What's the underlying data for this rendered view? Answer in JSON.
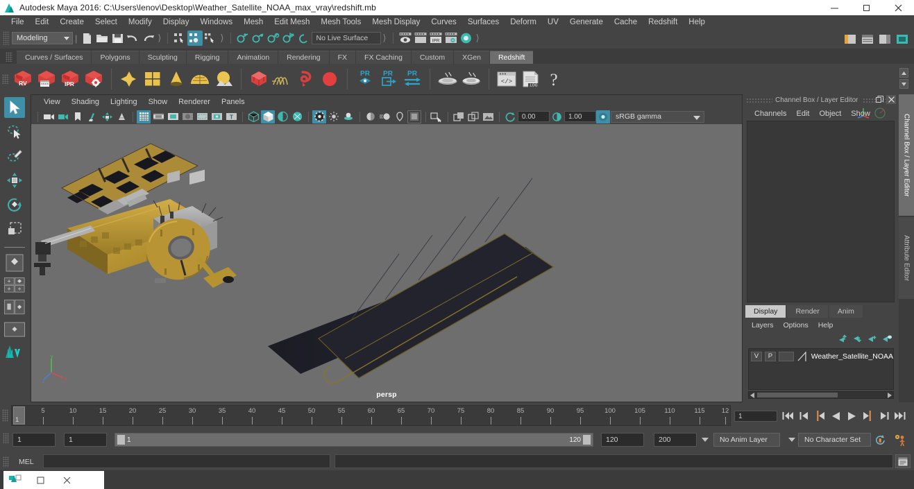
{
  "window": {
    "title": "Autodesk Maya 2016: C:\\Users\\lenov\\Desktop\\Weather_Satellite_NOAA_max_vray\\redshift.mb",
    "icon": "maya-logo-icon",
    "minimize": "–",
    "maximize": "❐",
    "close": "✕"
  },
  "menubar": {
    "items": [
      {
        "label": "File"
      },
      {
        "label": "Edit"
      },
      {
        "label": "Create"
      },
      {
        "label": "Select"
      },
      {
        "label": "Modify"
      },
      {
        "label": "Display"
      },
      {
        "label": "Windows"
      },
      {
        "label": "Mesh"
      },
      {
        "label": "Edit Mesh"
      },
      {
        "label": "Mesh Tools"
      },
      {
        "label": "Mesh Display"
      },
      {
        "label": "Curves"
      },
      {
        "label": "Surfaces"
      },
      {
        "label": "Deform"
      },
      {
        "label": "UV"
      },
      {
        "label": "Generate"
      },
      {
        "label": "Cache"
      },
      {
        "label": "Redshift"
      },
      {
        "label": "Help"
      }
    ]
  },
  "statusline": {
    "menuset": "Modeling",
    "live_surface": "No Live Surface",
    "icons": [
      "new-scene-icon",
      "open-scene-icon",
      "save-scene-icon",
      "undo-icon",
      "redo-icon",
      "select-by-hierarchy-icon",
      "select-by-object-icon",
      "select-by-component-icon",
      "snap-to-grid-icon",
      "snap-to-curve-icon",
      "snap-to-point-icon",
      "snap-to-projected-center-icon",
      "snap-to-view-plane-icon",
      "render-view-icon",
      "render-sequence-icon",
      "ipr-render-icon",
      "render-settings-icon",
      "hypershade-icon"
    ],
    "right_icons": [
      "sidebar-toggle-1-icon",
      "sidebar-toggle-2-icon",
      "sidebar-toggle-3-icon",
      "sidebar-toggle-4-icon"
    ]
  },
  "shelf": {
    "tabs": [
      {
        "label": "Curves / Surfaces",
        "active": false
      },
      {
        "label": "Polygons",
        "active": false
      },
      {
        "label": "Sculpting",
        "active": false
      },
      {
        "label": "Rigging",
        "active": false
      },
      {
        "label": "Animation",
        "active": false
      },
      {
        "label": "Rendering",
        "active": false
      },
      {
        "label": "FX",
        "active": false
      },
      {
        "label": "FX Caching",
        "active": false
      },
      {
        "label": "Custom",
        "active": false
      },
      {
        "label": "XGen",
        "active": false
      },
      {
        "label": "Redshift",
        "active": true
      }
    ],
    "buttons": [
      {
        "name": "redshift-render-view-icon",
        "label": "RV"
      },
      {
        "name": "redshift-render-sequence-icon",
        "label": ""
      },
      {
        "name": "redshift-ipr-icon",
        "label": "IPR"
      },
      {
        "name": "redshift-render-options-icon",
        "label": ""
      },
      {
        "name": "redshift-material-icon",
        "label": ""
      },
      {
        "name": "redshift-matte-icon",
        "label": ""
      },
      {
        "name": "redshift-light-cone-icon",
        "label": ""
      },
      {
        "name": "redshift-dome-light-icon",
        "label": ""
      },
      {
        "name": "redshift-ies-light-icon",
        "label": ""
      },
      {
        "name": "redshift-proxy-icon",
        "label": ""
      },
      {
        "name": "redshift-hair-icon",
        "label": ""
      },
      {
        "name": "redshift-volume-icon",
        "label": ""
      },
      {
        "name": "redshift-sphere-icon",
        "label": ""
      },
      {
        "name": "redshift-pr-object-icon",
        "label": "PR"
      },
      {
        "name": "redshift-pr-export-icon",
        "label": "PR"
      },
      {
        "name": "redshift-pr-transfer-icon",
        "label": "PR"
      },
      {
        "name": "redshift-bake-icon",
        "label": ""
      },
      {
        "name": "redshift-bake-set-icon",
        "label": ""
      },
      {
        "name": "redshift-script-editor-icon",
        "label": ""
      },
      {
        "name": "redshift-log-icon",
        "label": ".LOG"
      },
      {
        "name": "redshift-help-icon",
        "label": "?"
      }
    ]
  },
  "toolbox": {
    "tools": [
      {
        "name": "select-tool",
        "active": true
      },
      {
        "name": "lasso-select-tool",
        "active": false
      },
      {
        "name": "paint-select-tool",
        "active": false
      },
      {
        "name": "move-tool",
        "active": false
      },
      {
        "name": "rotate-tool",
        "active": false
      },
      {
        "name": "scale-tool",
        "active": false
      }
    ],
    "layouts": [
      {
        "name": "single-perspective-layout"
      },
      {
        "name": "four-view-layout"
      },
      {
        "name": "persp-outliner-layout"
      },
      {
        "name": "persp-graph-layout"
      },
      {
        "name": "maya-logo-watermark"
      }
    ]
  },
  "viewport": {
    "menus": [
      {
        "label": "View"
      },
      {
        "label": "Shading"
      },
      {
        "label": "Lighting"
      },
      {
        "label": "Show"
      },
      {
        "label": "Renderer"
      },
      {
        "label": "Panels"
      }
    ],
    "camera_label": "persp",
    "exposure": "0.00",
    "gamma": "1.00",
    "color_management": "sRGB gamma",
    "toolbar_icons": [
      "select-camera-icon",
      "bookmark-camera-icon",
      "camera-attributes-icon",
      "image-plane-icon",
      "two-d-pan-zoom-icon",
      "grid-toggle-icon",
      "film-gate-icon",
      "resolution-gate-icon",
      "gate-mask-icon",
      "field-chart-icon",
      "safe-action-icon",
      "safe-title-icon",
      "wireframe-shading-icon",
      "smooth-shade-all-icon",
      "smooth-shade-selected-icon",
      "shaded-wireframe-icon",
      "texture-toggle-icon",
      "lighting-toggle-icon",
      "shadows-toggle-icon",
      "screen-space-ao-icon",
      "motion-blur-icon",
      "multisample-aa-icon",
      "depth-of-field-icon",
      "isolate-select-icon",
      "xray-toggle-icon",
      "xray-joints-icon",
      "xray-active-components-icon",
      "exposure-icon",
      "gamma-icon",
      "color-management-icon"
    ],
    "scene_object": "Weather Satellite NOAA 3D model"
  },
  "channelbox": {
    "panel_title": "Channel Box / Layer Editor",
    "menus": [
      {
        "label": "Channels"
      },
      {
        "label": "Edit"
      },
      {
        "label": "Object"
      },
      {
        "label": "Show"
      }
    ],
    "undock_icon": "undock-panel-icon",
    "close_icon": "close-panel-icon",
    "empty": ""
  },
  "layereditor": {
    "tabs": [
      {
        "label": "Display",
        "active": true
      },
      {
        "label": "Render",
        "active": false
      },
      {
        "label": "Anim",
        "active": false
      }
    ],
    "menus": [
      {
        "label": "Layers"
      },
      {
        "label": "Options"
      },
      {
        "label": "Help"
      }
    ],
    "buttons": [
      {
        "name": "move-layer-up-icon"
      },
      {
        "name": "move-layer-down-icon"
      },
      {
        "name": "new-layer-icon"
      },
      {
        "name": "new-layer-from-selected-icon"
      }
    ],
    "layers": [
      {
        "visibility": "V",
        "playback": "P",
        "shading": "",
        "name": "Weather_Satellite_NOAA"
      }
    ]
  },
  "vertical_tabs": [
    {
      "label": "Channel Box / Layer Editor",
      "active": true
    },
    {
      "label": "Attribute Editor",
      "active": false
    }
  ],
  "timeslider": {
    "current_frame": "1",
    "playhead_label": "1",
    "ticks": [
      {
        "value": "5"
      },
      {
        "value": "10"
      },
      {
        "value": "15"
      },
      {
        "value": "20"
      },
      {
        "value": "25"
      },
      {
        "value": "30"
      },
      {
        "value": "35"
      },
      {
        "value": "40"
      },
      {
        "value": "45"
      },
      {
        "value": "50"
      },
      {
        "value": "55"
      },
      {
        "value": "60"
      },
      {
        "value": "65"
      },
      {
        "value": "70"
      },
      {
        "value": "75"
      },
      {
        "value": "80"
      },
      {
        "value": "85"
      },
      {
        "value": "90"
      },
      {
        "value": "95"
      },
      {
        "value": "100"
      },
      {
        "value": "105"
      },
      {
        "value": "110"
      },
      {
        "value": "115"
      },
      {
        "value": "12"
      }
    ],
    "playback_buttons": [
      {
        "name": "go-to-start-button"
      },
      {
        "name": "step-back-key-button"
      },
      {
        "name": "step-back-frame-button"
      },
      {
        "name": "play-backwards-button"
      },
      {
        "name": "play-forwards-button"
      },
      {
        "name": "step-forward-frame-button"
      },
      {
        "name": "step-forward-key-button"
      },
      {
        "name": "go-to-end-button"
      }
    ]
  },
  "rangeslider": {
    "anim_start": "1",
    "range_start": "1",
    "bar_start_label": "1",
    "bar_end_label": "120",
    "range_end": "120",
    "anim_end": "200",
    "anim_layer": "No Anim Layer",
    "character_set": "No Character Set",
    "auto_key_icon": "auto-keyframe-icon",
    "anim_prefs_icon": "animation-preferences-icon"
  },
  "commandline": {
    "language_label": "MEL",
    "input_value": "",
    "output_value": "",
    "script_editor_icon": "script-editor-icon"
  },
  "taskbar": {
    "app_icon": "maya-logo-icon",
    "restore": "▭",
    "close": "✕"
  },
  "colors": {
    "ui_bg": "#444444",
    "viewport_bg": "#6e6e6e",
    "accent": "#3f8fa8",
    "redshift_red": "#d9413f",
    "shelf_gold": "#e3bc4a",
    "title_bg": "#ffffff"
  }
}
